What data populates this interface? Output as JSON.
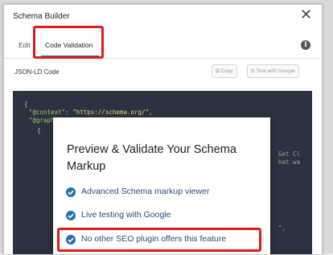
{
  "dialog": {
    "title": "Schema Builder",
    "close_icon": "close-icon"
  },
  "tabs": [
    {
      "label": "Edit",
      "active": false
    },
    {
      "label": "Code Validation",
      "active": true
    }
  ],
  "info_icon": {
    "glyph": "i",
    "icon": "info-icon"
  },
  "section": {
    "label": "JSON-LD Code",
    "copy_label": "Copy",
    "test_label": "Test with Google"
  },
  "code": {
    "line1": "{",
    "line2_key": "\"@context\"",
    "line2_sep": ": ",
    "line2_val": "\"https://schema.org/\",",
    "line3_key": "\"@graph\"",
    "line3_sep": ": [",
    "line4": "{",
    "side1": "Get Cl",
    "side2": "hat wa",
    "side3": "\","
  },
  "modal": {
    "title": "Preview & Validate Your Schema Markup",
    "features": [
      "Advanced Schema markup viewer",
      "Live testing with Google",
      "No other SEO plugin offers this feature"
    ]
  },
  "colors": {
    "accent": "#2271b1",
    "highlight": "#e01b1b",
    "code_bg": "#2c3340"
  }
}
